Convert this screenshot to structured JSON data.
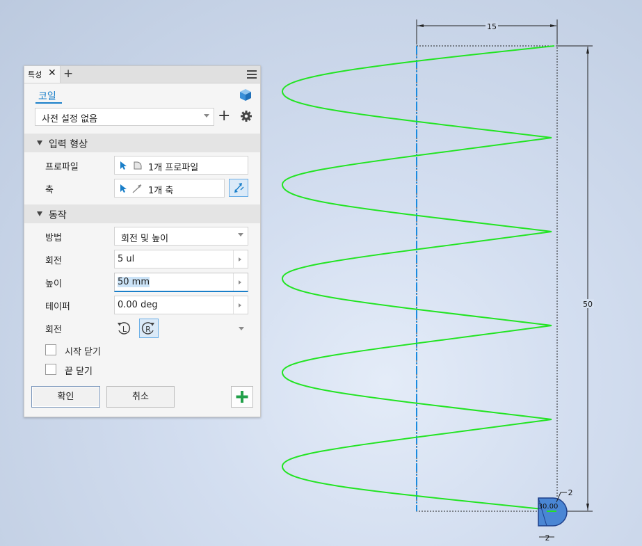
{
  "panel": {
    "tab_label": "특성",
    "tab_close": "✕",
    "tab_add": "+",
    "feature_title": "코일",
    "preset": {
      "value": "사전 설정 없음",
      "add_label": "+"
    },
    "input_section": {
      "title": "입력 형상",
      "profile_label": "프로파일",
      "profile_value": "1개 프로파일",
      "axis_label": "축",
      "axis_value": "1개 축"
    },
    "behavior_section": {
      "title": "동작",
      "method_label": "방법",
      "method_value": "회전 및 높이",
      "revolution_label": "회전",
      "revolution_value": "5 ul",
      "height_label": "높이",
      "height_value": "50 mm",
      "taper_label": "테이퍼",
      "taper_value": "0.00 deg",
      "rotation_label": "회전"
    },
    "checkboxes": {
      "close_start": "시작 닫기",
      "close_end": "끝 닫기"
    },
    "buttons": {
      "ok": "확인",
      "cancel": "취소"
    }
  },
  "viewport": {
    "dimension_width": "15",
    "dimension_height": "50",
    "dimension_small_top": "2",
    "dimension_small_bottom": "2",
    "dimension_angle": "30.00",
    "coil_color": "#22e422",
    "axis_color": "#1a8be0"
  },
  "colors": {
    "accent": "#1a7fc9",
    "green_add": "#22a04a"
  }
}
